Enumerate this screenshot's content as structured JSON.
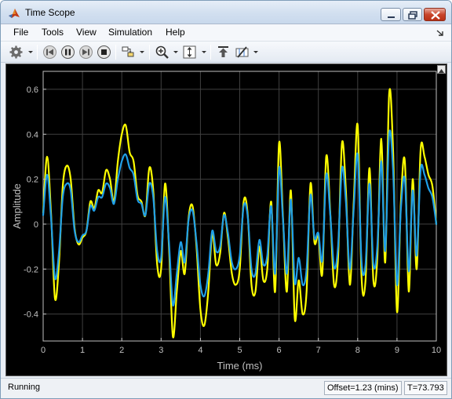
{
  "window": {
    "title": "Time Scope"
  },
  "menu": {
    "items": [
      {
        "label": "File"
      },
      {
        "label": "Tools"
      },
      {
        "label": "View"
      },
      {
        "label": "Simulation"
      },
      {
        "label": "Help"
      }
    ]
  },
  "toolbar": {
    "buttons": [
      {
        "icon": "settings-gear-icon",
        "dropdown": true
      },
      {
        "icon": "step-back-icon"
      },
      {
        "icon": "pause-icon"
      },
      {
        "icon": "step-forward-icon"
      },
      {
        "icon": "stop-icon"
      },
      {
        "icon": "highlight-block-icon",
        "dropdown": true
      },
      {
        "icon": "zoom-in-icon",
        "dropdown": true
      },
      {
        "icon": "scale-axes-icon",
        "dropdown": true
      },
      {
        "icon": "keep-on-top-icon"
      },
      {
        "icon": "cursor-measurements-icon",
        "dropdown": true
      }
    ]
  },
  "colors": {
    "plot_background": "#000000",
    "axes": "#c0c0c0",
    "grid": "#404040",
    "series_1": "#ffff00",
    "series_2": "#1f9fe8"
  },
  "chart_data": {
    "type": "line",
    "title": "",
    "xlabel": "Time (ms)",
    "ylabel": "Amplitude",
    "xlim": [
      0,
      10
    ],
    "ylim": [
      -0.52,
      0.68
    ],
    "x_ticks": [
      "0",
      "1",
      "2",
      "3",
      "4",
      "5",
      "6",
      "7",
      "8",
      "9",
      "10"
    ],
    "y_ticks": [
      "-0.4",
      "-0.2",
      "0",
      "0.2",
      "0.4",
      "0.6"
    ],
    "y_tick_values": [
      -0.4,
      -0.2,
      0,
      0.2,
      0.4,
      0.6
    ],
    "grid": true,
    "series": [
      {
        "color": "#ffff00",
        "x": [
          0,
          0.1,
          0.2,
          0.3,
          0.4,
          0.5,
          0.6,
          0.7,
          0.8,
          0.9,
          1.0,
          1.1,
          1.2,
          1.3,
          1.4,
          1.5,
          1.6,
          1.7,
          1.8,
          1.9,
          2.0,
          2.1,
          2.2,
          2.3,
          2.4,
          2.5,
          2.6,
          2.7,
          2.8,
          2.9,
          3.0,
          3.1,
          3.2,
          3.3,
          3.4,
          3.5,
          3.6,
          3.7,
          3.8,
          3.9,
          4.0,
          4.1,
          4.2,
          4.3,
          4.4,
          4.5,
          4.6,
          4.7,
          4.8,
          4.9,
          5.0,
          5.1,
          5.2,
          5.3,
          5.4,
          5.5,
          5.6,
          5.7,
          5.8,
          5.9,
          6.0,
          6.1,
          6.2,
          6.3,
          6.4,
          6.5,
          6.6,
          6.7,
          6.8,
          6.9,
          7.0,
          7.1,
          7.2,
          7.3,
          7.4,
          7.5,
          7.6,
          7.7,
          7.8,
          7.9,
          8.0,
          8.1,
          8.2,
          8.3,
          8.4,
          8.5,
          8.6,
          8.7,
          8.8,
          8.9,
          9.0,
          9.1,
          9.2,
          9.3,
          9.4,
          9.5,
          9.6,
          9.7,
          9.8,
          9.9,
          10.0
        ],
        "values": [
          0.05,
          0.3,
          0.05,
          -0.33,
          -0.18,
          0.17,
          0.26,
          0.2,
          -0.02,
          -0.09,
          -0.06,
          -0.03,
          0.1,
          0.07,
          0.15,
          0.14,
          0.24,
          0.2,
          0.1,
          0.28,
          0.4,
          0.44,
          0.32,
          0.28,
          0.13,
          0.1,
          0.04,
          0.25,
          0.15,
          -0.18,
          -0.2,
          0.18,
          -0.1,
          -0.5,
          -0.3,
          -0.12,
          -0.22,
          0.03,
          0.08,
          -0.1,
          -0.38,
          -0.45,
          -0.3,
          -0.04,
          -0.18,
          -0.13,
          0.05,
          -0.06,
          -0.22,
          -0.27,
          -0.2,
          0.1,
          0.05,
          -0.27,
          -0.3,
          -0.1,
          -0.25,
          -0.2,
          0.1,
          -0.3,
          0.36,
          0.03,
          -0.3,
          0.15,
          -0.42,
          -0.25,
          -0.4,
          -0.3,
          0.18,
          -0.08,
          -0.05,
          -0.22,
          0.3,
          0.06,
          -0.27,
          -0.15,
          0.36,
          0.15,
          -0.27,
          0.1,
          0.44,
          -0.24,
          -0.25,
          0.25,
          -0.25,
          -0.15,
          0.38,
          -0.17,
          0.58,
          0.33,
          -0.39,
          0.1,
          0.28,
          -0.3,
          0.2,
          -0.2,
          0.33,
          0.3,
          0.22,
          0.17,
          0.0
        ]
      },
      {
        "color": "#1f9fe8",
        "x": [
          0,
          0.1,
          0.2,
          0.3,
          0.4,
          0.5,
          0.6,
          0.7,
          0.8,
          0.9,
          1.0,
          1.1,
          1.2,
          1.3,
          1.4,
          1.5,
          1.6,
          1.7,
          1.8,
          1.9,
          2.0,
          2.1,
          2.2,
          2.3,
          2.4,
          2.5,
          2.6,
          2.7,
          2.8,
          2.9,
          3.0,
          3.1,
          3.2,
          3.3,
          3.4,
          3.5,
          3.6,
          3.7,
          3.8,
          3.9,
          4.0,
          4.1,
          4.2,
          4.3,
          4.4,
          4.5,
          4.6,
          4.7,
          4.8,
          4.9,
          5.0,
          5.1,
          5.2,
          5.3,
          5.4,
          5.5,
          5.6,
          5.7,
          5.8,
          5.9,
          6.0,
          6.1,
          6.2,
          6.3,
          6.4,
          6.5,
          6.6,
          6.7,
          6.8,
          6.9,
          7.0,
          7.1,
          7.2,
          7.3,
          7.4,
          7.5,
          7.6,
          7.7,
          7.8,
          7.9,
          8.0,
          8.1,
          8.2,
          8.3,
          8.4,
          8.5,
          8.6,
          8.7,
          8.8,
          8.9,
          9.0,
          9.1,
          9.2,
          9.3,
          9.4,
          9.5,
          9.6,
          9.7,
          9.8,
          9.9,
          10.0
        ],
        "values": [
          0.04,
          0.22,
          0.03,
          -0.24,
          -0.13,
          0.12,
          0.18,
          0.15,
          -0.03,
          -0.08,
          -0.05,
          -0.03,
          0.08,
          0.06,
          0.12,
          0.12,
          0.18,
          0.16,
          0.09,
          0.2,
          0.28,
          0.31,
          0.25,
          0.22,
          0.11,
          0.09,
          0.04,
          0.18,
          0.12,
          -0.12,
          -0.15,
          0.12,
          -0.08,
          -0.36,
          -0.22,
          -0.08,
          -0.17,
          0.02,
          0.06,
          -0.08,
          -0.27,
          -0.32,
          -0.22,
          -0.03,
          -0.12,
          -0.1,
          0.04,
          -0.04,
          -0.17,
          -0.2,
          -0.14,
          0.08,
          0.04,
          -0.2,
          -0.22,
          -0.07,
          -0.18,
          -0.14,
          0.08,
          -0.22,
          0.25,
          0.02,
          -0.22,
          0.11,
          -0.26,
          -0.15,
          -0.27,
          -0.2,
          0.13,
          -0.06,
          -0.04,
          -0.16,
          0.22,
          0.05,
          -0.19,
          -0.1,
          0.25,
          0.1,
          -0.2,
          0.07,
          0.31,
          -0.17,
          -0.18,
          0.18,
          -0.18,
          -0.1,
          0.28,
          -0.12,
          0.4,
          0.24,
          -0.27,
          0.07,
          0.2,
          -0.21,
          0.15,
          -0.14,
          0.24,
          0.22,
          0.16,
          0.12,
          0.0
        ]
      }
    ]
  },
  "status": {
    "state": "Running",
    "offset": "Offset=1.23 (mins)",
    "time": "T=73.793"
  }
}
